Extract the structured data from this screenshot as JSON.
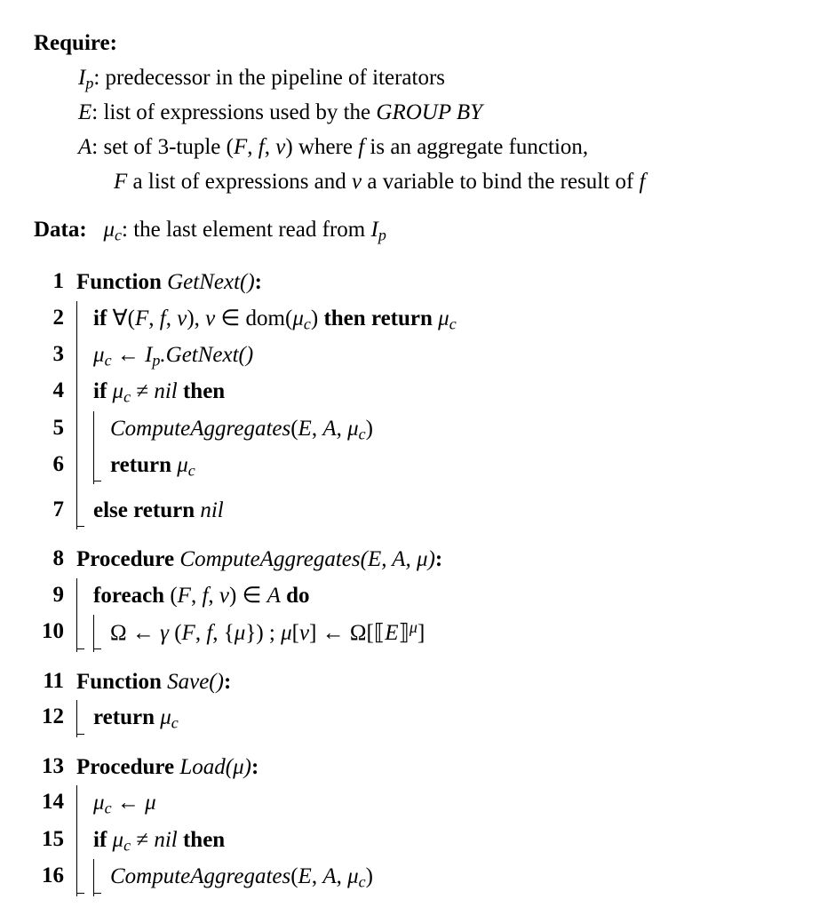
{
  "require": {
    "label": "Require:",
    "ip_name": "I",
    "ip_sub": "p",
    "ip_desc": ": predecessor in the pipeline of iterators",
    "e_name": "E",
    "e_desc": ": list of expressions used by the ",
    "e_groupby": "GROUP BY",
    "a_name": "A",
    "a_desc1": ": set of 3-tuple (",
    "a_tuple_F": "F",
    "a_sep1": ", ",
    "a_tuple_f": "f",
    "a_sep2": ", ",
    "a_tuple_v": "v",
    "a_desc2": ") where ",
    "a_desc3": " is an aggregate function,",
    "a_line2a": "F",
    "a_line2b": " a list of expressions and ",
    "a_line2c": "v",
    "a_line2d": " a variable to bind the result of ",
    "a_line2e": "f"
  },
  "data": {
    "label": "Data:",
    "mu": "μ",
    "mu_sub": "c",
    "desc": ": the last element read from ",
    "ip": "I",
    "ip_sub": "p"
  },
  "lines": {
    "kw_function": "Function",
    "kw_procedure": "Procedure",
    "kw_if": "if",
    "kw_then": "then",
    "kw_return": "return",
    "kw_else": "else",
    "kw_foreach": "foreach",
    "kw_do": "do",
    "getnext_sig": "GetNext()",
    "compute_sig": "ComputeAggregates(E, A, μ)",
    "save_sig": "Save()",
    "load_sig": "Load(μ)",
    "l2_forall": "∀(",
    "l2_F": "F",
    "l2_s1": ", ",
    "l2_f": "f",
    "l2_s2": ", ",
    "l2_v": "v",
    "l2_close": "), ",
    "l2_vin": "v",
    "l2_in": " ∈ dom(",
    "l2_mu": "μ",
    "l2_musub": "c",
    "l2_end": ") ",
    "l2_ret_mu": "μ",
    "l2_ret_sub": "c",
    "l3_mu": "μ",
    "l3_musub": "c",
    "l3_arrow": " ← ",
    "l3_ip": "I",
    "l3_ipsub": "p",
    "l3_call": ".GetNext()",
    "l4_mu": "μ",
    "l4_musub": "c",
    "l4_ne": " ≠ ",
    "l4_nil": "nil",
    "l5_call": "ComputeAggregates",
    "l5_open": "(",
    "l5_E": "E",
    "l5_s1": ", ",
    "l5_A": "A",
    "l5_s2": ", ",
    "l5_mu": "μ",
    "l5_musub": "c",
    "l5_close": ")",
    "l6_mu": "μ",
    "l6_musub": "c",
    "l7_nil": "nil",
    "l9_open": "(",
    "l9_F": "F",
    "l9_s1": ", ",
    "l9_f": "f",
    "l9_s2": ", ",
    "l9_v": "v",
    "l9_close": ") ∈ ",
    "l9_A": "A",
    "l10_omega": "Ω ← ",
    "l10_gamma": "γ",
    "l10_open": " (",
    "l10_F": "F",
    "l10_s1": ", ",
    "l10_f": "f",
    "l10_s2": ", {",
    "l10_mu": "μ",
    "l10_close": "}) ; ",
    "l10_mu2": "μ",
    "l10_br1": "[",
    "l10_v": "v",
    "l10_br2": "] ← Ω[",
    "l10_sem1": "⟦",
    "l10_E": "E",
    "l10_sem2": "⟧",
    "l10_supmu": "μ",
    "l10_br3": "]",
    "l12_mu": "μ",
    "l12_musub": "c",
    "l14_mu": "μ",
    "l14_musub": "c",
    "l14_arrow": " ← ",
    "l14_mu2": "μ",
    "l15_mu": "μ",
    "l15_musub": "c",
    "l15_ne": " ≠ ",
    "l15_nil": "nil",
    "l16_call": "ComputeAggregates",
    "l16_open": "(",
    "l16_E": "E",
    "l16_s1": ", ",
    "l16_A": "A",
    "l16_s2": ", ",
    "l16_mu": "μ",
    "l16_musub": "c",
    "l16_close": ")"
  },
  "nums": {
    "n1": "1",
    "n2": "2",
    "n3": "3",
    "n4": "4",
    "n5": "5",
    "n6": "6",
    "n7": "7",
    "n8": "8",
    "n9": "9",
    "n10": "10",
    "n11": "11",
    "n12": "12",
    "n13": "13",
    "n14": "14",
    "n15": "15",
    "n16": "16"
  }
}
